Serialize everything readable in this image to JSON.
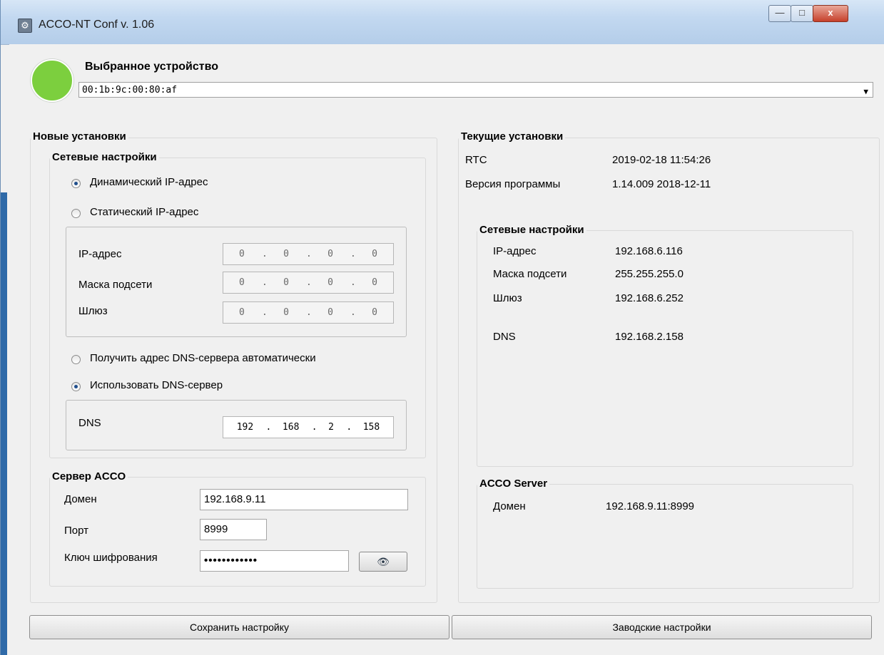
{
  "window": {
    "title": "ACCO-NT Conf v. 1.06",
    "controls": {
      "minimize": "—",
      "maximize": "□",
      "close": "x"
    }
  },
  "device": {
    "label": "Выбранное устройство",
    "selected": "00:1b:9c:00:80:af",
    "status_color": "#7ccf3e"
  },
  "new_settings": {
    "title": "Новые установки",
    "network": {
      "title": "Сетевые настройки",
      "dynamic_ip": "Динамический  IP-адрес",
      "static_ip": "Статический IP-адрес",
      "ip_mode": "dynamic",
      "ip_label": "IP-адрес",
      "mask_label": "Маска подсети",
      "gateway_label": "Шлюз",
      "ip": [
        "0",
        "0",
        "0",
        "0"
      ],
      "mask": [
        "0",
        "0",
        "0",
        "0"
      ],
      "gateway": [
        "0",
        "0",
        "0",
        "0"
      ],
      "dns_auto": "Получить адрес DNS-сервера автоматически",
      "dns_manual": "Использовать DNS-сервер",
      "dns_mode": "manual",
      "dns_label": "DNS",
      "dns": [
        "192",
        "168",
        "2",
        "158"
      ]
    },
    "acco_server": {
      "title": "Сервер ACCO",
      "domain_label": "Домен",
      "domain": "192.168.9.11",
      "port_label": "Порт",
      "port": "8999",
      "key_label": "Ключ шифрования",
      "key": "••••••••••••",
      "show_key_icon": "eye-icon"
    }
  },
  "current_settings": {
    "title": "Текущие установки",
    "rtc_label": "RTC",
    "rtc": "2019-02-18 11:54:26",
    "version_label": "Версия программы",
    "version": "1.14.009 2018-12-11",
    "network": {
      "title": "Сетевые настройки",
      "ip_label": "IP-адрес",
      "ip": "192.168.6.116",
      "mask_label": "Маска подсети",
      "mask": "255.255.255.0",
      "gateway_label": "Шлюз",
      "gateway": "192.168.6.252",
      "dns_label": "DNS",
      "dns": "192.168.2.158"
    },
    "acco_server": {
      "title": "ACCO Server",
      "domain_label": "Домен",
      "domain": "192.168.9.11:8999"
    }
  },
  "buttons": {
    "save": "Сохранить настройку",
    "factory": "Заводские настройки"
  }
}
